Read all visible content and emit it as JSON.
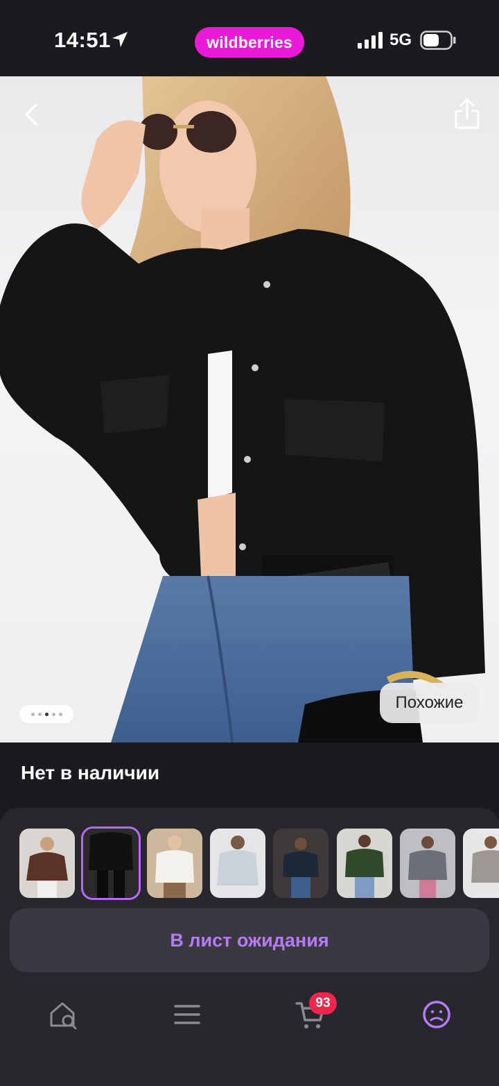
{
  "status_bar": {
    "time": "14:51",
    "network": "5G",
    "brand": "wildberries"
  },
  "product": {
    "image_icon": "product-photo",
    "carousel_dots": 5,
    "carousel_active_index": 2,
    "similar_label": "Похожие",
    "availability": "Нет в наличии"
  },
  "variants": {
    "count": 8,
    "selected_index": 1,
    "items": [
      {
        "icon": "variant-thumbnail"
      },
      {
        "icon": "variant-thumbnail"
      },
      {
        "icon": "variant-thumbnail"
      },
      {
        "icon": "variant-thumbnail"
      },
      {
        "icon": "variant-thumbnail"
      },
      {
        "icon": "variant-thumbnail"
      },
      {
        "icon": "variant-thumbnail"
      },
      {
        "icon": "variant-thumbnail"
      }
    ]
  },
  "actions": {
    "waitlist_label": "В лист ожидания"
  },
  "nav": {
    "items": [
      {
        "icon": "home-search-icon"
      },
      {
        "icon": "catalog-menu-icon"
      },
      {
        "icon": "cart-icon"
      },
      {
        "icon": "profile-icon"
      }
    ],
    "cart_count": "93"
  },
  "colors": {
    "brand": "#ea1ad8",
    "accent": "#b67af5",
    "badge": "#f0254b",
    "background": "#1b1a1f"
  }
}
